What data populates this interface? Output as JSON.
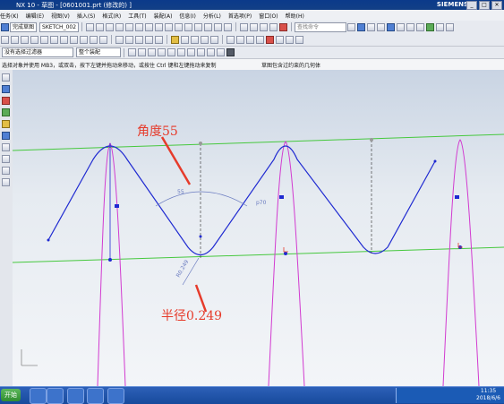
{
  "window": {
    "title": "NX 10 - 草图 - [0601001.prt (修改的)  ]",
    "brand": "SIEMENS",
    "controls": [
      "_",
      "□",
      "✕"
    ]
  },
  "menu": [
    "任务(K)",
    "编辑(E)",
    "视图(V)",
    "插入(S)",
    "格式(R)",
    "工具(T)",
    "装配(A)",
    "信息(I)",
    "分析(L)",
    "首选项(P)",
    "窗口(O)",
    "帮助(H)"
  ],
  "toolbar1": {
    "finish_label": "完成草图",
    "sketch_name": "SKETCH_002",
    "search_placeholder": "查找命令"
  },
  "toolbar3": {
    "filter": "没有选择过滤器",
    "scope": "整个装配"
  },
  "status": {
    "left": "选择对象并使用 MB3，或双击，按下左键并拖动来移动，或按住 Ctrl 键和左键拖动来复制",
    "right": "草图包含过约束的几何体"
  },
  "annotations": {
    "angle": "角度55",
    "radius": "半径0.249"
  },
  "dimension_labels": {
    "angle_value": "55",
    "line_dim": "p70",
    "radius_dim": "R0.249"
  },
  "colors": {
    "sketch_curve": "#1f2ad1",
    "guide_line": "#46c83e",
    "conic_curve": "#d23ad0",
    "annotation_red": "#e63b2b"
  },
  "taskbar": {
    "start_label": "开始",
    "clock_time": "11:35",
    "clock_date": "2018/6/6"
  }
}
